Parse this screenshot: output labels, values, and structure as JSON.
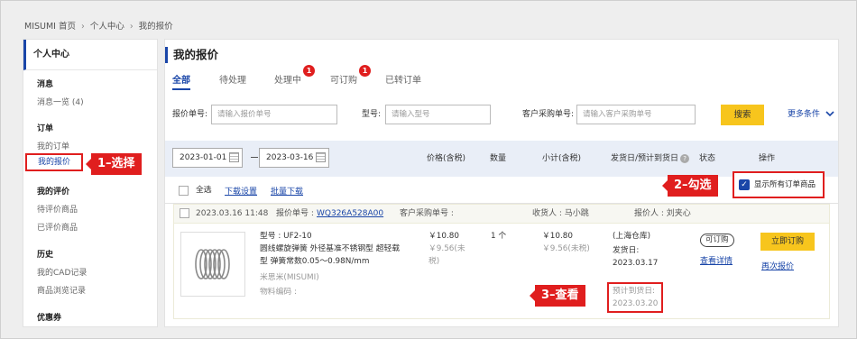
{
  "breadcrumb": [
    "MISUMI 首页",
    "个人中心",
    "我的报价"
  ],
  "sidebar": {
    "title": "个人中心",
    "sections": [
      {
        "title": "消息",
        "items": [
          "消息一览 (4)"
        ]
      },
      {
        "title": "订单",
        "items": [
          "我的订单",
          "我的报价"
        ]
      },
      {
        "title": "我的评价",
        "items": [
          "待评价商品",
          "已评价商品"
        ]
      },
      {
        "title": "历史",
        "items": [
          "我的CAD记录",
          "商品浏览记录"
        ]
      },
      {
        "title": "优惠券",
        "items": []
      }
    ]
  },
  "callouts": {
    "step1": "1–选择",
    "step2": "2–勾选",
    "step3": "3–查看"
  },
  "page": {
    "title": "我的报价"
  },
  "tabs": [
    {
      "label": "全部",
      "active": true
    },
    {
      "label": "待处理"
    },
    {
      "label": "处理中",
      "badge": "1"
    },
    {
      "label": "可订购",
      "badge": "1"
    },
    {
      "label": "已转订单"
    }
  ],
  "search": {
    "quote_no_label": "报价单号:",
    "quote_no_placeholder": "请输入报价单号",
    "model_label": "型号:",
    "model_placeholder": "请输入型号",
    "cust_po_label": "客户采购单号:",
    "cust_po_placeholder": "请输入客户采购单号",
    "search_button": "搜索",
    "more_conditions": "更多条件"
  },
  "date_range": {
    "from": "2023-01-01",
    "to": "2023-03-16"
  },
  "columns": {
    "price": "价格(含税)",
    "qty": "数量",
    "subtotal": "小计(含税)",
    "ship": "发货日/预计到货日",
    "status": "状态",
    "action": "操作"
  },
  "toolbar": {
    "select_all": "全选",
    "download_settings": "下载设置",
    "batch_download": "批量下载",
    "show_all": "显示所有订单商品"
  },
  "order": {
    "datetime": "2023.03.16 11:48",
    "quote_no_label": "报价单号 :",
    "quote_no": "WQ326A528A00",
    "cust_po_label": "客户采购单号 :",
    "receiver_label": "收货人 : 马小跳",
    "quoter_label": "报价人 : 刘夹心",
    "item": {
      "model_line": "型号 : UF2-10",
      "desc_lines": [
        "圆线螺旋弹簧 外径基准不锈钢型 超轻载",
        "型 弹簧常数0.05～0.98N/mm"
      ],
      "brand": "米思米(MISUMI)",
      "material_code_label": "物料编码 :",
      "price": "￥10.80",
      "price_excl": [
        "￥9.56(未",
        "税)"
      ],
      "qty": "1 个",
      "subtotal": "￥10.80",
      "subtotal_excl": "￥9.56(未税)",
      "warehouse": "(上海仓库)",
      "ship_label": "发货日:",
      "ship_date": "2023.03.17",
      "eta_label": "预计到货日:",
      "eta_date": "2023.03.20",
      "status": "可订购",
      "detail_link": "查看详情",
      "order_button": "立即订购",
      "requote_link": "再次报价"
    }
  },
  "colors": {
    "accent_blue": "#1a46a8",
    "highlight_red": "#e01e1e",
    "button_yellow": "#f7c51d"
  },
  "icons": [
    "chevron-right-icon",
    "calendar-icon",
    "question-icon",
    "chevron-down-icon",
    "checkbox-icon",
    "spring-icon"
  ]
}
